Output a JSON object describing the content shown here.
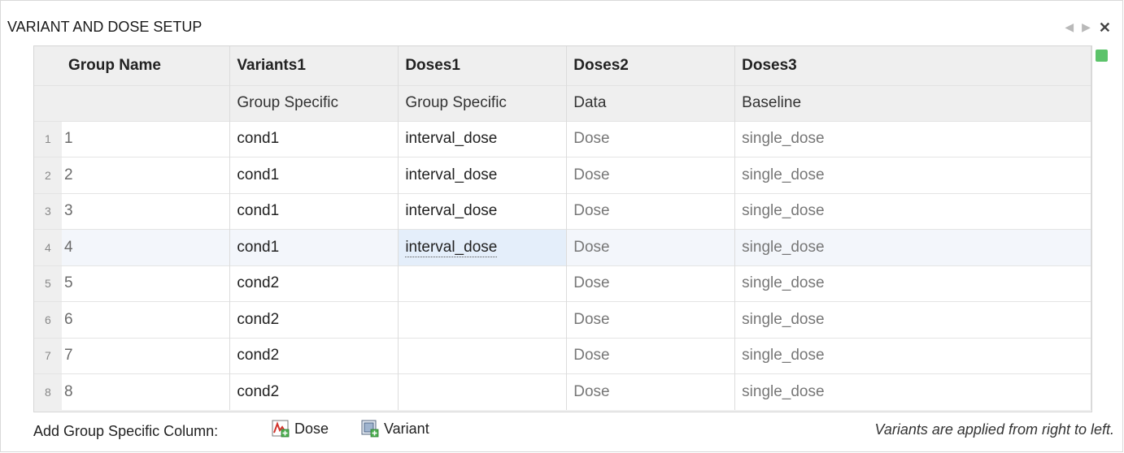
{
  "panel": {
    "title": "VARIANT AND DOSE SETUP"
  },
  "columns": [
    {
      "header": "Group Name",
      "sub": ""
    },
    {
      "header": "Variants1",
      "sub": "Group Specific"
    },
    {
      "header": "Doses1",
      "sub": "Group Specific"
    },
    {
      "header": "Doses2",
      "sub": "Data"
    },
    {
      "header": "Doses3",
      "sub": "Baseline"
    }
  ],
  "rows": [
    {
      "index": "1",
      "group": "1",
      "variant": "cond1",
      "dose1": "interval_dose",
      "dose2": "Dose",
      "dose3": "single_dose"
    },
    {
      "index": "2",
      "group": "2",
      "variant": "cond1",
      "dose1": "interval_dose",
      "dose2": "Dose",
      "dose3": "single_dose"
    },
    {
      "index": "3",
      "group": "3",
      "variant": "cond1",
      "dose1": "interval_dose",
      "dose2": "Dose",
      "dose3": "single_dose"
    },
    {
      "index": "4",
      "group": "4",
      "variant": "cond1",
      "dose1": "interval_dose",
      "dose2": "Dose",
      "dose3": "single_dose"
    },
    {
      "index": "5",
      "group": "5",
      "variant": "cond2",
      "dose1": "",
      "dose2": "Dose",
      "dose3": "single_dose"
    },
    {
      "index": "6",
      "group": "6",
      "variant": "cond2",
      "dose1": "",
      "dose2": "Dose",
      "dose3": "single_dose"
    },
    {
      "index": "7",
      "group": "7",
      "variant": "cond2",
      "dose1": "",
      "dose2": "Dose",
      "dose3": "single_dose"
    },
    {
      "index": "8",
      "group": "8",
      "variant": "cond2",
      "dose1": "",
      "dose2": "Dose",
      "dose3": "single_dose"
    }
  ],
  "footer": {
    "add_label": "Add Group Specific Column:",
    "dose_button": "Dose",
    "variant_button": "Variant",
    "note": "Variants are applied from right to left."
  },
  "icons": {
    "prev": "chevron-left-icon",
    "next": "chevron-right-icon",
    "close": "close-icon",
    "status": "status-indicator-icon",
    "add_dose": "add-dose-icon",
    "add_variant": "add-variant-icon"
  },
  "colors": {
    "status_green": "#5cc36a",
    "selected_cell": "#e4eefa",
    "header_bg": "#efefef"
  }
}
